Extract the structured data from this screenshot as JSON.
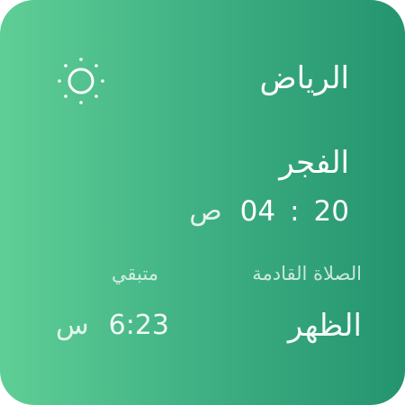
{
  "widget": {
    "city": "الرياض",
    "weather_icon": "sun-icon",
    "current_prayer": {
      "name": "الفجر",
      "hours": "20",
      "separator": ":",
      "minutes": "04",
      "period": "ص"
    },
    "labels": {
      "next_prayer": "الصلاة القادمة",
      "remaining": "متبقي"
    },
    "next_prayer": {
      "name": "الظهر",
      "remaining_value": "6:23",
      "remaining_unit": "س"
    }
  }
}
